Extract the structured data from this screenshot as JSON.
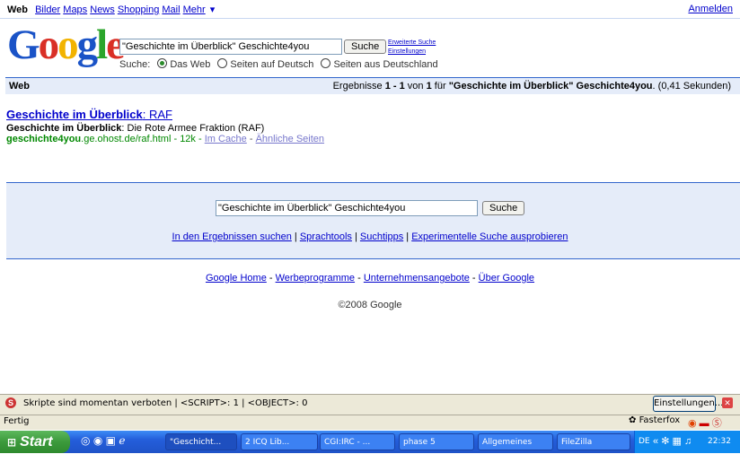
{
  "topnav": {
    "current": "Web",
    "links": [
      "Bilder",
      "Maps",
      "News",
      "Shopping",
      "Mail"
    ],
    "more": "Mehr",
    "more_arrow": "▾",
    "signin": "Anmelden"
  },
  "logo": {
    "G": "G",
    "o1": "o",
    "o2": "o",
    "g": "g",
    "l": "l",
    "e": "e"
  },
  "search": {
    "query": "\"Geschichte im Überblick\" Geschichte4you",
    "button": "Suche",
    "advanced": "Erweiterte Suche",
    "settings": "Einstellungen",
    "scope_label": "Suche:",
    "scope_options": [
      "Das Web",
      "Seiten auf Deutsch",
      "Seiten aus Deutschland"
    ],
    "scope_selected": 0
  },
  "results_bar": {
    "label": "Web",
    "stats_prefix": "Ergebnisse",
    "range": "1 - 1",
    "of": "von",
    "total": "1",
    "for": "für",
    "query": "\"Geschichte im Überblick\" Geschichte4you",
    "time": "(0,41 Sekunden)"
  },
  "result": {
    "title_bold": "Geschichte im Überblick",
    "title_rest": ": RAF",
    "snippet_bold": "Geschichte im Überblick",
    "snippet_rest": ": Die Rote Armee Fraktion (RAF)",
    "url_bold": "geschichte4you",
    "url_rest": ".ge.ohost.de/raf.html - 12k -",
    "cache": "Im Cache",
    "sep": "-",
    "similar": "Ähnliche Seiten"
  },
  "bottom": {
    "query": "\"Geschichte im Überblick\" Geschichte4you",
    "button": "Suche",
    "links": [
      "In den Ergebnissen suchen",
      "Sprachtools",
      "Suchtipps",
      "Experimentelle Suche ausprobieren"
    ],
    "footer_links": [
      "Google Home",
      "Werbeprogramme",
      "Unternehmensangebote",
      "Über Google"
    ],
    "copyright": "©2008 Google"
  },
  "scriptbar": {
    "text": "Skripte sind momentan verboten | <SCRIPT>: 1 | <OBJECT>: 0",
    "button": "Einstellungen..."
  },
  "statusbar": {
    "status": "Fertig",
    "fasterfox": "Fasterfox"
  },
  "taskbar": {
    "start": "Start",
    "tasks": [
      "\"Geschicht...",
      "2 ICQ Lib...",
      "CGI:IRC - ...",
      "phase 5",
      "Allgemeines",
      "FileZilla"
    ],
    "lang": "DE",
    "clock": "22:32"
  }
}
